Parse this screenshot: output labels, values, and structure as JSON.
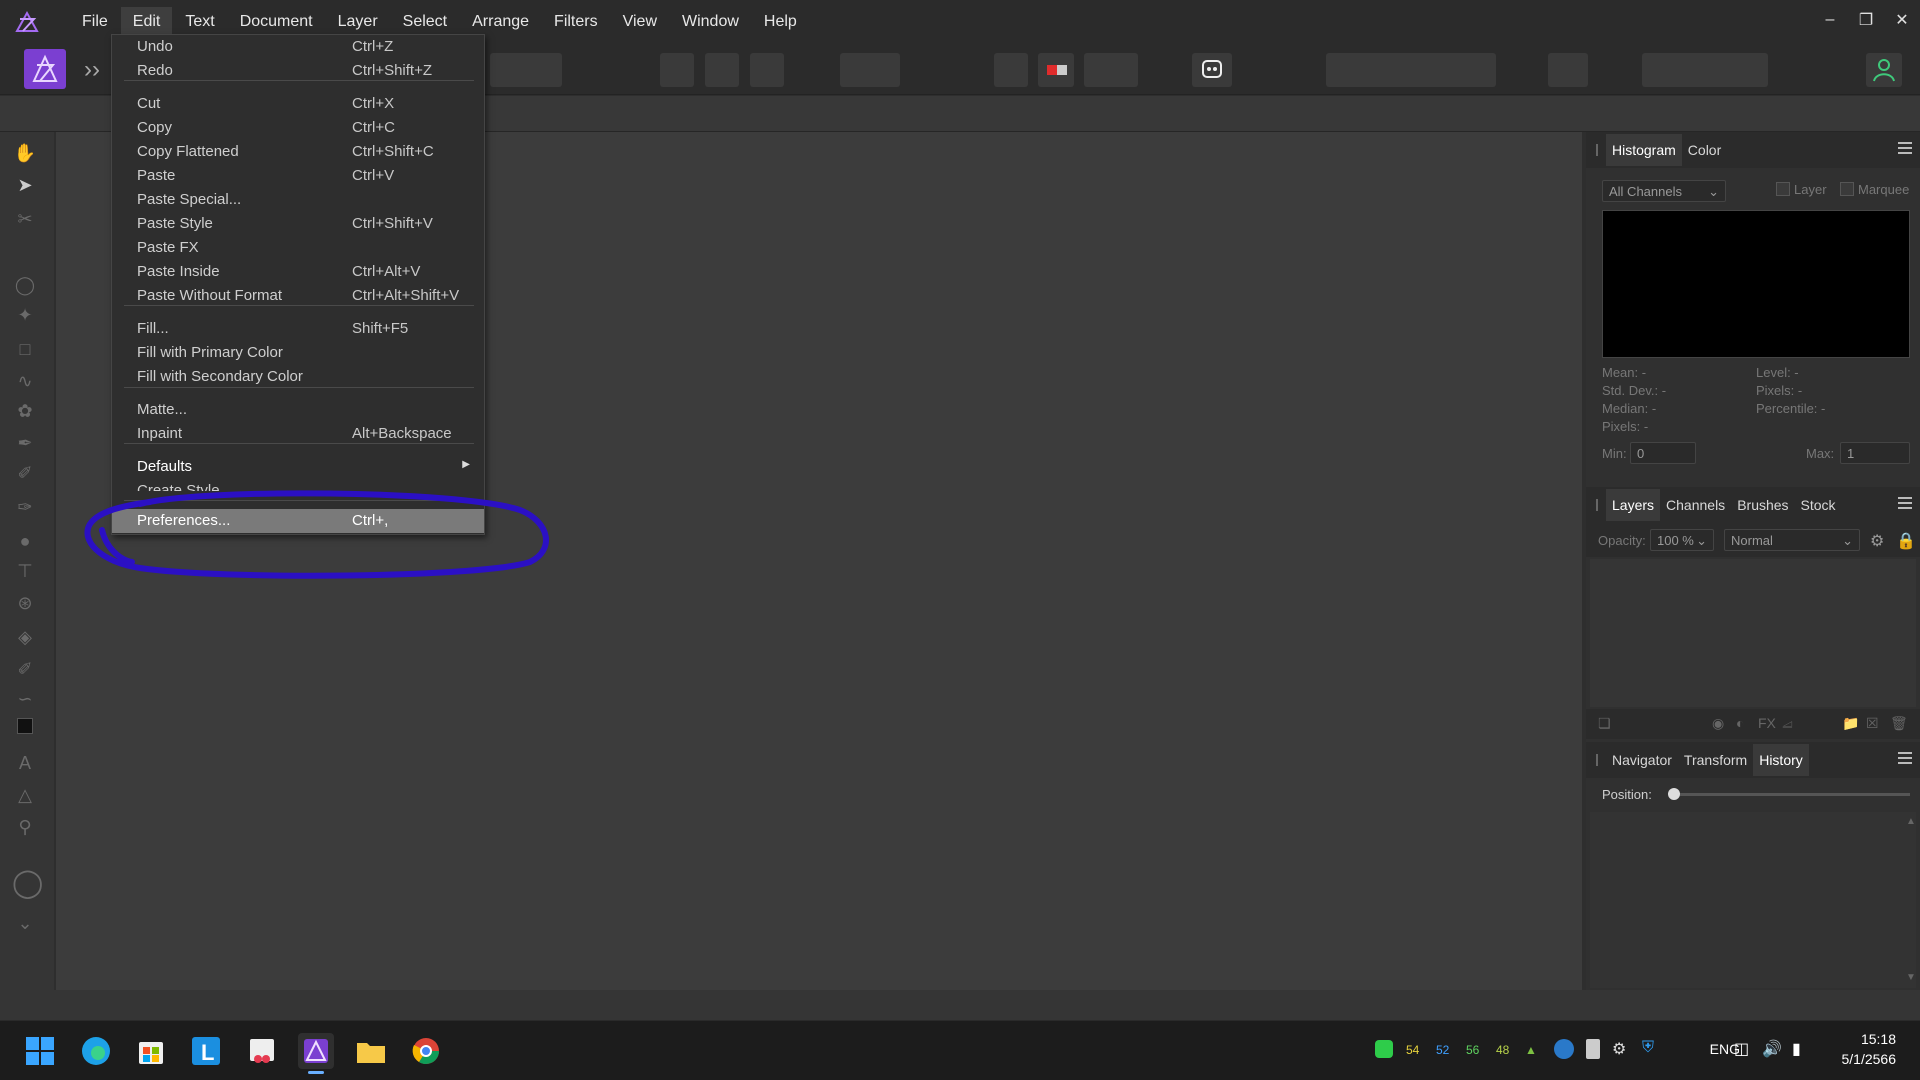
{
  "menubar": {
    "items": [
      "File",
      "Edit",
      "Text",
      "Document",
      "Layer",
      "Select",
      "Arrange",
      "Filters",
      "View",
      "Window",
      "Help"
    ],
    "active_index": 1
  },
  "edit_menu": {
    "items": [
      {
        "label": "Undo",
        "shortcut": "Ctrl+Z"
      },
      {
        "label": "Redo",
        "shortcut": "Ctrl+Shift+Z"
      },
      {
        "label": "Cut",
        "shortcut": "Ctrl+X"
      },
      {
        "label": "Copy",
        "shortcut": "Ctrl+C"
      },
      {
        "label": "Copy Flattened",
        "shortcut": "Ctrl+Shift+C"
      },
      {
        "label": "Paste",
        "shortcut": "Ctrl+V"
      },
      {
        "label": "Paste Special...",
        "shortcut": ""
      },
      {
        "label": "Paste Style",
        "shortcut": "Ctrl+Shift+V"
      },
      {
        "label": "Paste FX",
        "shortcut": ""
      },
      {
        "label": "Paste Inside",
        "shortcut": "Ctrl+Alt+V"
      },
      {
        "label": "Paste Without Format",
        "shortcut": "Ctrl+Alt+Shift+V"
      },
      {
        "label": "Fill...",
        "shortcut": "Shift+F5"
      },
      {
        "label": "Fill with Primary Color",
        "shortcut": ""
      },
      {
        "label": "Fill with Secondary Color",
        "shortcut": ""
      },
      {
        "label": "Matte...",
        "shortcut": ""
      },
      {
        "label": "Inpaint",
        "shortcut": "Alt+Backspace"
      },
      {
        "label": "Defaults",
        "shortcut": ""
      },
      {
        "label": "Create Style",
        "shortcut": ""
      },
      {
        "label": "Preferences...",
        "shortcut": "Ctrl+,"
      }
    ],
    "highlighted": "Preferences...",
    "annotation_color": "#2b10c4"
  },
  "histogram_panel": {
    "tabs": [
      "Histogram",
      "Color"
    ],
    "active_tab": "Histogram",
    "channel_select": "All Channels",
    "layer_label": "Layer",
    "marquee_label": "Marquee",
    "stats_left": [
      "Mean: -",
      "Std. Dev.: -",
      "Median: -",
      "Pixels: -"
    ],
    "stats_right": [
      "Level: -",
      "Pixels: -",
      "Percentile: -"
    ],
    "min_label": "Min:",
    "min_value": "0",
    "max_label": "Max:",
    "max_value": "1"
  },
  "layers_panel": {
    "tabs": [
      "Layers",
      "Channels",
      "Brushes",
      "Stock"
    ],
    "active_tab": "Layers",
    "opacity_label": "Opacity:",
    "opacity_value": "100 %",
    "blend_mode": "Normal"
  },
  "history_panel": {
    "tabs": [
      "Navigator",
      "Transform",
      "History"
    ],
    "active_tab": "History",
    "position_label": "Position:"
  },
  "taskbar": {
    "tray_numbers": [
      {
        "value": "54",
        "color": "#e6d23c"
      },
      {
        "value": "52",
        "color": "#3fa0ff"
      },
      {
        "value": "56",
        "color": "#5fd35f"
      },
      {
        "value": "48",
        "color": "#b7d34a"
      }
    ],
    "language": "ENG",
    "time": "15:18",
    "date": "5/1/2566"
  },
  "colors": {
    "accent": "#7b3fd1",
    "menu_highlight": "#7a7a7a"
  }
}
